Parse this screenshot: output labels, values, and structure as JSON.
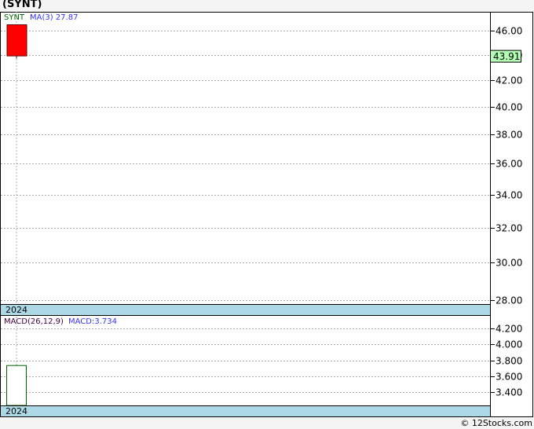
{
  "title": "(SYNT)",
  "footer": "© 12Stocks.com",
  "colors": {
    "down_candle": "#ff0000",
    "macd_bar": "#006400",
    "date_band": "#add8e6",
    "last_price_bg": "#b3ffb3"
  },
  "chart_data": [
    {
      "type": "candlestick",
      "ticker_label": "SYNT",
      "indicator_label": "MA(3)",
      "indicator_value": "27.87",
      "y_scale": "log",
      "ylim": [
        27.5,
        47.2
      ],
      "yticks": [
        46,
        44,
        42,
        40,
        38,
        36,
        34,
        32,
        30,
        28
      ],
      "ytick_labels": [
        "46.00",
        "44.00",
        "42.00",
        "40.00",
        "38.00",
        "36.00",
        "34.00",
        "32.00",
        "30.00",
        "28.00"
      ],
      "x_label": "2024",
      "last_price": "43.91",
      "candles": [
        {
          "open": 46.5,
          "high": 46.5,
          "low": 43.7,
          "close": 43.91
        }
      ],
      "grid": true
    },
    {
      "type": "bar",
      "label": "MACD(26,12,9)",
      "value_label": "MACD:3.734",
      "ylim": [
        3.2,
        4.3
      ],
      "yticks": [
        4.2,
        4.0,
        3.8,
        3.6,
        3.4
      ],
      "ytick_labels": [
        "4.200",
        "4.000",
        "3.800",
        "3.600",
        "3.400"
      ],
      "x_label": "2024",
      "values": [
        3.734
      ],
      "grid": true
    }
  ]
}
